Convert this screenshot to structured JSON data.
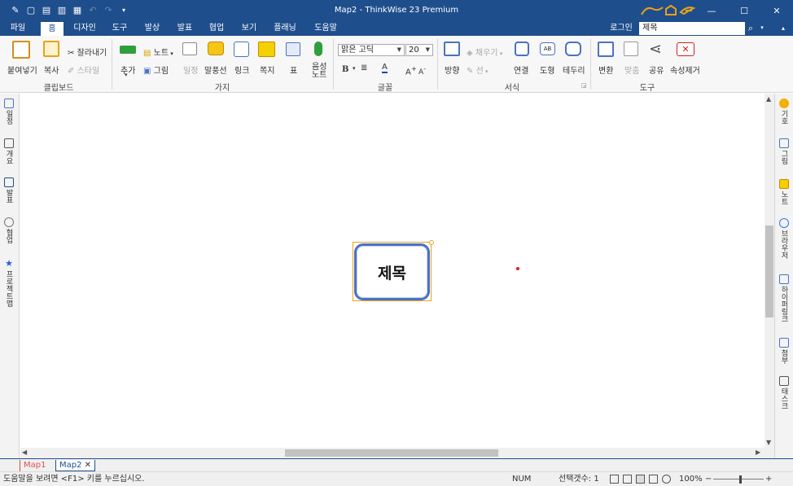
{
  "window": {
    "title": "Map2 - ThinkWise 23 Premium",
    "brand_logo": "thinkwise-logo",
    "controls": [
      "minimize-icon",
      "maximize-icon",
      "close-icon"
    ]
  },
  "qat": [
    "file-tool-icon",
    "new-icon",
    "open-icon",
    "save-icon",
    "print-icon",
    "undo-icon",
    "redo-icon",
    "qat-dropdown-icon"
  ],
  "menu": {
    "tabs": [
      "파일",
      "홈",
      "디자인",
      "도구",
      "발상",
      "발표",
      "협업",
      "보기",
      "플래닝",
      "도움말"
    ],
    "active": "홈",
    "login": "로그인",
    "search_value": "제목"
  },
  "ribbon": {
    "clipboard": {
      "label": "클립보드",
      "paste": "붙여넣기",
      "copy": "복사",
      "cut": "잘라내기",
      "style": "스타일"
    },
    "branch": {
      "label": "가지",
      "add": "추가",
      "note": "노트",
      "image": "그림",
      "schedule": "일정",
      "callout": "말풍선",
      "link": "링크",
      "sticky": "쪽지",
      "table": "표",
      "voice_line1": "음성",
      "voice_line2": "노트"
    },
    "font": {
      "label": "글꼴",
      "family": "맑은 고딕",
      "size": "20",
      "bold": "B"
    },
    "format": {
      "label": "서식",
      "direction": "방향",
      "fill": "채우기",
      "line": "선",
      "connect": "연결",
      "shape": "도형",
      "shape_icon_text": "AB",
      "border": "테두리"
    },
    "tools": {
      "label": "도구",
      "convert": "변환",
      "align": "맞춤",
      "share": "공유",
      "clear_props": "속성제거"
    }
  },
  "left_panel": [
    "일정",
    "개요",
    "발표",
    "협업",
    "프로젝트맵"
  ],
  "right_panel": [
    "기호",
    "그림",
    "노트",
    "브라우저",
    "하이퍼링크",
    "첨부",
    "태스크"
  ],
  "canvas": {
    "central_topic": "제목"
  },
  "doc_tabs": [
    {
      "label": "Map1",
      "active": false
    },
    {
      "label": "Map2",
      "active": true,
      "close": "✕"
    }
  ],
  "status": {
    "help": "도움말을 보려면 <F1> 키를 누르십시오.",
    "num": "NUM",
    "selection": "선택갯수: 1",
    "zoom": "100%",
    "zoom_minus": "−",
    "zoom_plus": "+"
  },
  "colors": {
    "titlebar": "#1f4e8c",
    "accent_orange": "#e8a21a",
    "topic_border": "#4a72c4"
  }
}
